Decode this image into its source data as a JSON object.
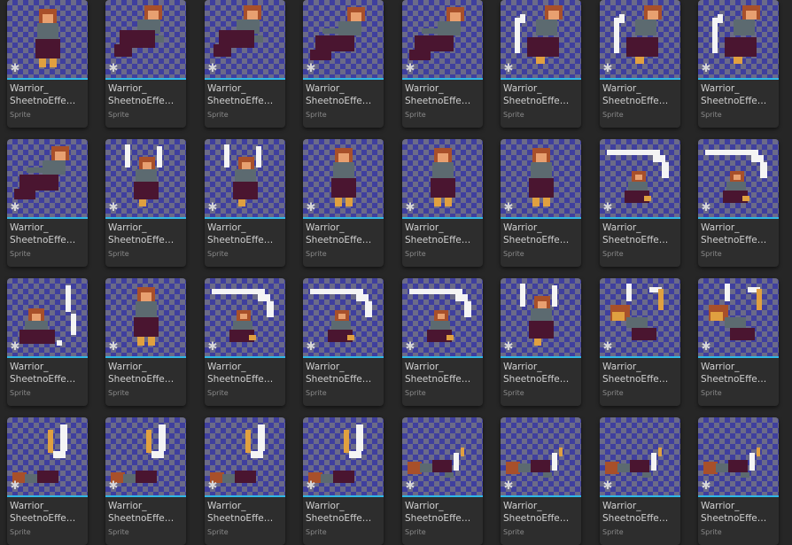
{
  "asset_browser": {
    "accent_color": "#2fb7e6",
    "assets": [
      {
        "name": "Warrior_\nSheetnoEffe…",
        "type": "Sprite",
        "pose": "stand"
      },
      {
        "name": "Warrior_\nSheetnoEffe…",
        "type": "Sprite",
        "pose": "leap"
      },
      {
        "name": "Warrior_\nSheetnoEffe…",
        "type": "Sprite",
        "pose": "leap"
      },
      {
        "name": "Warrior_\nSheetnoEffe…",
        "type": "Sprite",
        "pose": "dash"
      },
      {
        "name": "Warrior_\nSheetnoEffe…",
        "type": "Sprite",
        "pose": "dash"
      },
      {
        "name": "Warrior_\nSheetnoEffe…",
        "type": "Sprite",
        "pose": "slash"
      },
      {
        "name": "Warrior_\nSheetnoEffe…",
        "type": "Sprite",
        "pose": "slash"
      },
      {
        "name": "Warrior_\nSheetnoEffe…",
        "type": "Sprite",
        "pose": "slash"
      },
      {
        "name": "Warrior_\nSheetnoEffe…",
        "type": "Sprite",
        "pose": "dash"
      },
      {
        "name": "Warrior_\nSheetnoEffe…",
        "type": "Sprite",
        "pose": "raise"
      },
      {
        "name": "Warrior_\nSheetnoEffe…",
        "type": "Sprite",
        "pose": "raise"
      },
      {
        "name": "Warrior_\nSheetnoEffe…",
        "type": "Sprite",
        "pose": "stand"
      },
      {
        "name": "Warrior_\nSheetnoEffe…",
        "type": "Sprite",
        "pose": "stand"
      },
      {
        "name": "Warrior_\nSheetnoEffe…",
        "type": "Sprite",
        "pose": "stand"
      },
      {
        "name": "Warrior_\nSheetnoEffe…",
        "type": "Sprite",
        "pose": "arc"
      },
      {
        "name": "Warrior_\nSheetnoEffe…",
        "type": "Sprite",
        "pose": "arc"
      },
      {
        "name": "Warrior_\nSheetnoEffe…",
        "type": "Sprite",
        "pose": "crouch"
      },
      {
        "name": "Warrior_\nSheetnoEffe…",
        "type": "Sprite",
        "pose": "stand"
      },
      {
        "name": "Warrior_\nSheetnoEffe…",
        "type": "Sprite",
        "pose": "arc"
      },
      {
        "name": "Warrior_\nSheetnoEffe…",
        "type": "Sprite",
        "pose": "arc"
      },
      {
        "name": "Warrior_\nSheetnoEffe…",
        "type": "Sprite",
        "pose": "arc"
      },
      {
        "name": "Warrior_\nSheetnoEffe…",
        "type": "Sprite",
        "pose": "raise"
      },
      {
        "name": "Warrior_\nSheetnoEffe…",
        "type": "Sprite",
        "pose": "hit"
      },
      {
        "name": "Warrior_\nSheetnoEffe…",
        "type": "Sprite",
        "pose": "hit"
      },
      {
        "name": "Warrior_\nSheetnoEffe…",
        "type": "Sprite",
        "pose": "fall"
      },
      {
        "name": "Warrior_\nSheetnoEffe…",
        "type": "Sprite",
        "pose": "fall"
      },
      {
        "name": "Warrior_\nSheetnoEffe…",
        "type": "Sprite",
        "pose": "fall"
      },
      {
        "name": "Warrior_\nSheetnoEffe…",
        "type": "Sprite",
        "pose": "fall"
      },
      {
        "name": "Warrior_\nSheetnoEffe…",
        "type": "Sprite",
        "pose": "down"
      },
      {
        "name": "Warrior_\nSheetnoEffe…",
        "type": "Sprite",
        "pose": "down"
      },
      {
        "name": "Warrior_\nSheetnoEffe…",
        "type": "Sprite",
        "pose": "down"
      },
      {
        "name": "Warrior_\nSheetnoEffe…",
        "type": "Sprite",
        "pose": "down"
      }
    ]
  }
}
